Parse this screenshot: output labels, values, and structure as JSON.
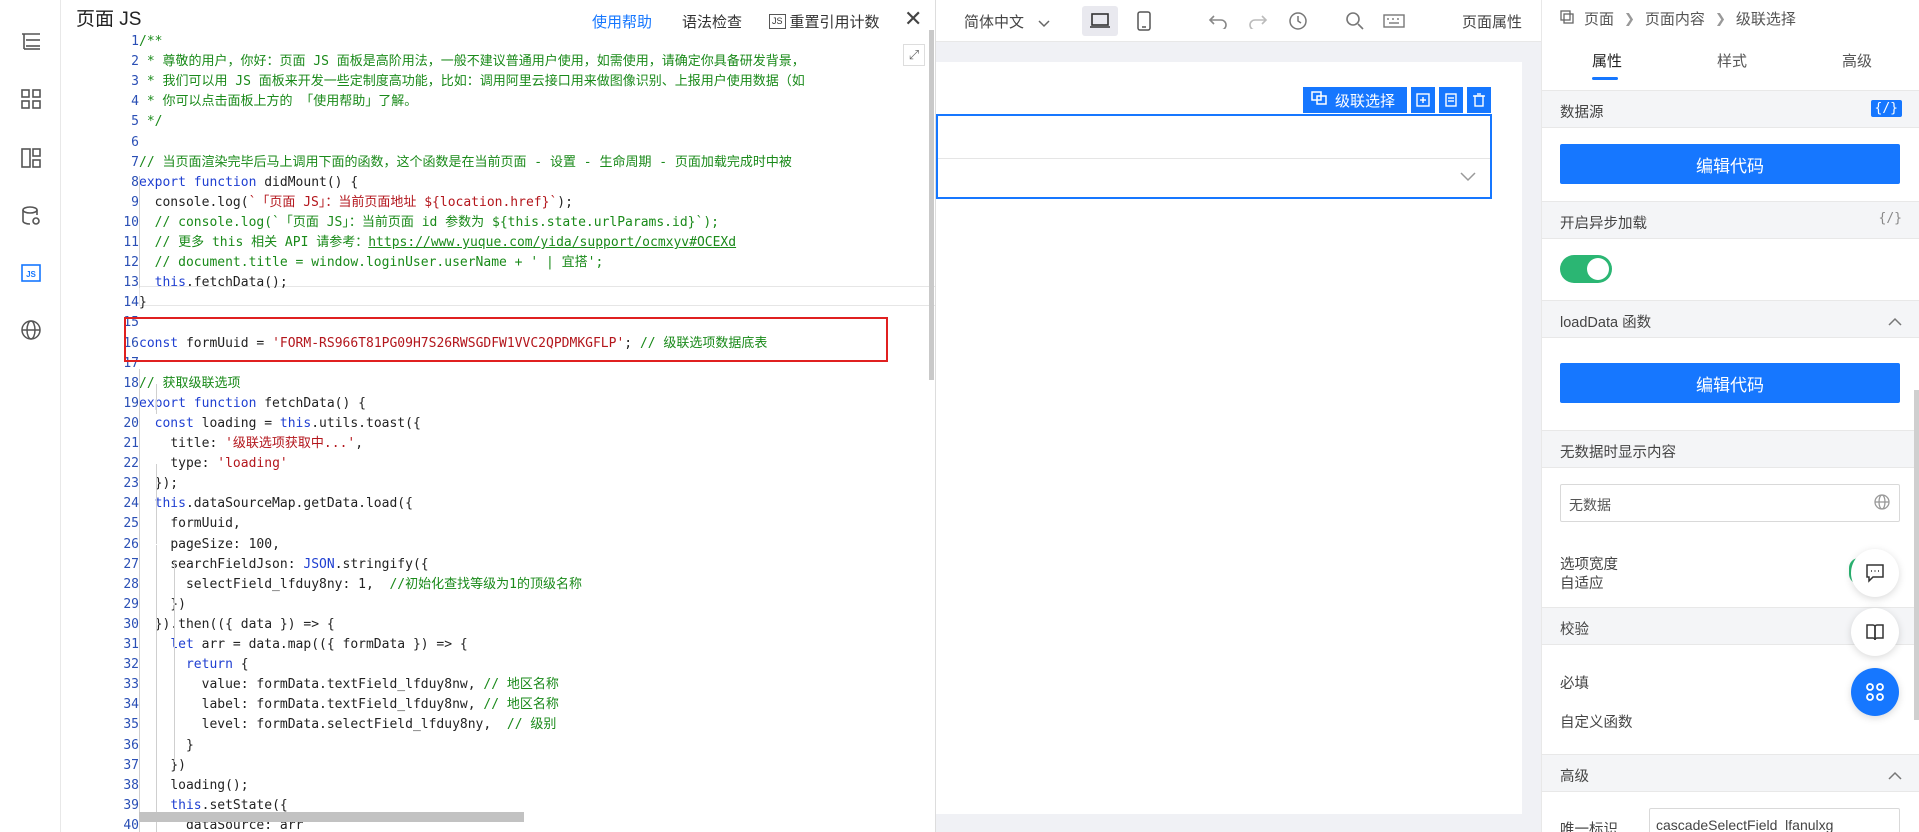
{
  "js_panel": {
    "title": "页面 JS",
    "help_link": "使用帮助",
    "syntax_check": "语法检查",
    "reset_count_icon": "JS",
    "reset_count": "重置引用计数",
    "close_icon": "close-icon"
  },
  "code_lines": [
    {
      "n": "1",
      "html": "<span class='cmt'>/**</span>"
    },
    {
      "n": "2",
      "html": "<span class='cmt'> * 尊敬的用户，你好：页面 JS 面板是高阶用法，一般不建议普通用户使用，如需使用，请确定你具备研发背景，</span>"
    },
    {
      "n": "3",
      "html": "<span class='cmt'> * 我们可以用 JS 面板来开发一些定制度高功能，比如：调用阿里云接口用来做图像识别、上报用户使用数据（如</span>"
    },
    {
      "n": "4",
      "html": "<span class='cmt'> * 你可以点击面板上方的 「使用帮助」了解。</span>"
    },
    {
      "n": "5",
      "html": "<span class='cmt'> */</span>"
    },
    {
      "n": "6",
      "html": ""
    },
    {
      "n": "7",
      "html": "<span class='cmt'>// 当页面渲染完毕后马上调用下面的函数，这个函数是在当前页面 - 设置 - 生命周期 - 页面加载完成时中被</span>"
    },
    {
      "n": "8",
      "html": "<span class='kw'>export function</span> <span class='var'>didMount() {</span>"
    },
    {
      "n": "9",
      "html": "  <span class='var'>console.log(</span><span class='str'>`「页面 JS」：当前页面地址 ${location.href}`</span><span class='var'>);</span>"
    },
    {
      "n": "10",
      "html": "  <span class='cmt'>// console.log(`「页面 JS」：当前页面 id 参数为 ${this.state.urlParams.id}`);</span>"
    },
    {
      "n": "11",
      "html": "  <span class='cmt'>// 更多 this 相关 API 请参考：<u>https://www.yuque.com/yida/support/ocmxyv#OCEXd</u></span>"
    },
    {
      "n": "12",
      "html": "  <span class='cmt'>// document.title = window.loginUser.userName + ' | 宜搭';</span>"
    },
    {
      "n": "13",
      "html": "  <span class='kw'>this</span><span class='var'>.fetchData();</span>"
    },
    {
      "n": "14",
      "html": "<span class='var'>}</span>"
    },
    {
      "n": "15",
      "html": ""
    },
    {
      "n": "16",
      "html": "<span class='kw'>const</span> <span class='var'>formUuid =</span> <span class='str'>'FORM-RS966T81PG09H7S26RWSGDFW1VVC2QPDMKGFLP'</span><span class='var'>;</span> <span class='cmt'>// 级联选项数据底表</span>"
    },
    {
      "n": "17",
      "html": ""
    },
    {
      "n": "18",
      "html": "<span class='cmt'>// 获取级联选项</span>"
    },
    {
      "n": "19",
      "html": "<span class='kw'>export function</span> <span class='var'>fetchData() {</span>"
    },
    {
      "n": "20",
      "html": "  <span class='kw'>const</span> <span class='var'>loading =</span> <span class='kw'>this</span><span class='var'>.utils.toast({</span>"
    },
    {
      "n": "21",
      "html": "    <span class='var'>title:</span> <span class='str'>'级联选项获取中...'</span><span class='var'>,</span>"
    },
    {
      "n": "22",
      "html": "    <span class='var'>type:</span> <span class='str'>'loading'</span>"
    },
    {
      "n": "23",
      "html": "  <span class='var'>});</span>"
    },
    {
      "n": "24",
      "html": "  <span class='kw'>this</span><span class='var'>.dataSourceMap.getData.load({</span>"
    },
    {
      "n": "25",
      "html": "    <span class='var'>formUuid,</span>"
    },
    {
      "n": "26",
      "html": "    <span class='var'>pageSize:</span> <span class='var'>100,</span>"
    },
    {
      "n": "27",
      "html": "    <span class='var'>searchFieldJson:</span> <span class='kw'>JSON</span><span class='var'>.stringify({</span>"
    },
    {
      "n": "28",
      "html": "      <span class='var'>selectField_lfduy8ny: 1,</span>  <span class='cmt'>//初始化查找等级为1的顶级名称</span>"
    },
    {
      "n": "29",
      "html": "    <span class='var'>})</span>"
    },
    {
      "n": "30",
      "html": "  <span class='var'>}).then(({ data }) => {</span>"
    },
    {
      "n": "31",
      "html": "    <span class='kw'>let</span> <span class='var'>arr = data.map(({ formData }) => {</span>"
    },
    {
      "n": "32",
      "html": "      <span class='kw'>return</span> <span class='var'>{</span>"
    },
    {
      "n": "33",
      "html": "        <span class='var'>value: formData.textField_lfduy8nw,</span> <span class='cmt'>// 地区名称</span>"
    },
    {
      "n": "34",
      "html": "        <span class='var'>label: formData.textField_lfduy8nw,</span> <span class='cmt'>// 地区名称</span>"
    },
    {
      "n": "35",
      "html": "        <span class='var'>level: formData.selectField_lfduy8ny,</span>  <span class='cmt'>// 级别</span>"
    },
    {
      "n": "36",
      "html": "      <span class='var'>}</span>"
    },
    {
      "n": "37",
      "html": "    <span class='var'>})</span>"
    },
    {
      "n": "38",
      "html": "    <span class='var'>loading();</span>"
    },
    {
      "n": "39",
      "html": "    <span class='kw'>this</span><span class='var'>.setState({</span>"
    },
    {
      "n": "40",
      "html": "      <span class='var'>dataSource: arr</span>"
    }
  ],
  "toolbar": {
    "lang_select": "简体中文",
    "page_attrs": "页面属性"
  },
  "canvas": {
    "component_label": "级联选择"
  },
  "right_panel": {
    "breadcrumb": [
      "页面",
      "页面内容",
      "级联选择"
    ],
    "tabs": [
      "属性",
      "样式",
      "高级"
    ],
    "datasource_title": "数据源",
    "fx_badge": "{/}",
    "edit_code_1": "编辑代码",
    "async_load_title": "开启异步加载",
    "async_load_enabled": true,
    "loaddata_title": "loadData 函数",
    "edit_code_2": "编辑代码",
    "empty_content_title": "无数据时显示内容",
    "empty_content_value": "无数据",
    "option_width_label": "选项宽度",
    "option_width_value": "自适应",
    "validation_title": "校验",
    "required_label": "必填",
    "custom_func_label": "自定义函数",
    "advanced_title": "高级",
    "unique_id_label": "唯一标识",
    "unique_id_value": "cascadeSelectField_lfanulxg"
  },
  "colors": {
    "accent": "#1677ff",
    "toggle_on": "#2bb673",
    "highlight_border": "#e02020"
  }
}
